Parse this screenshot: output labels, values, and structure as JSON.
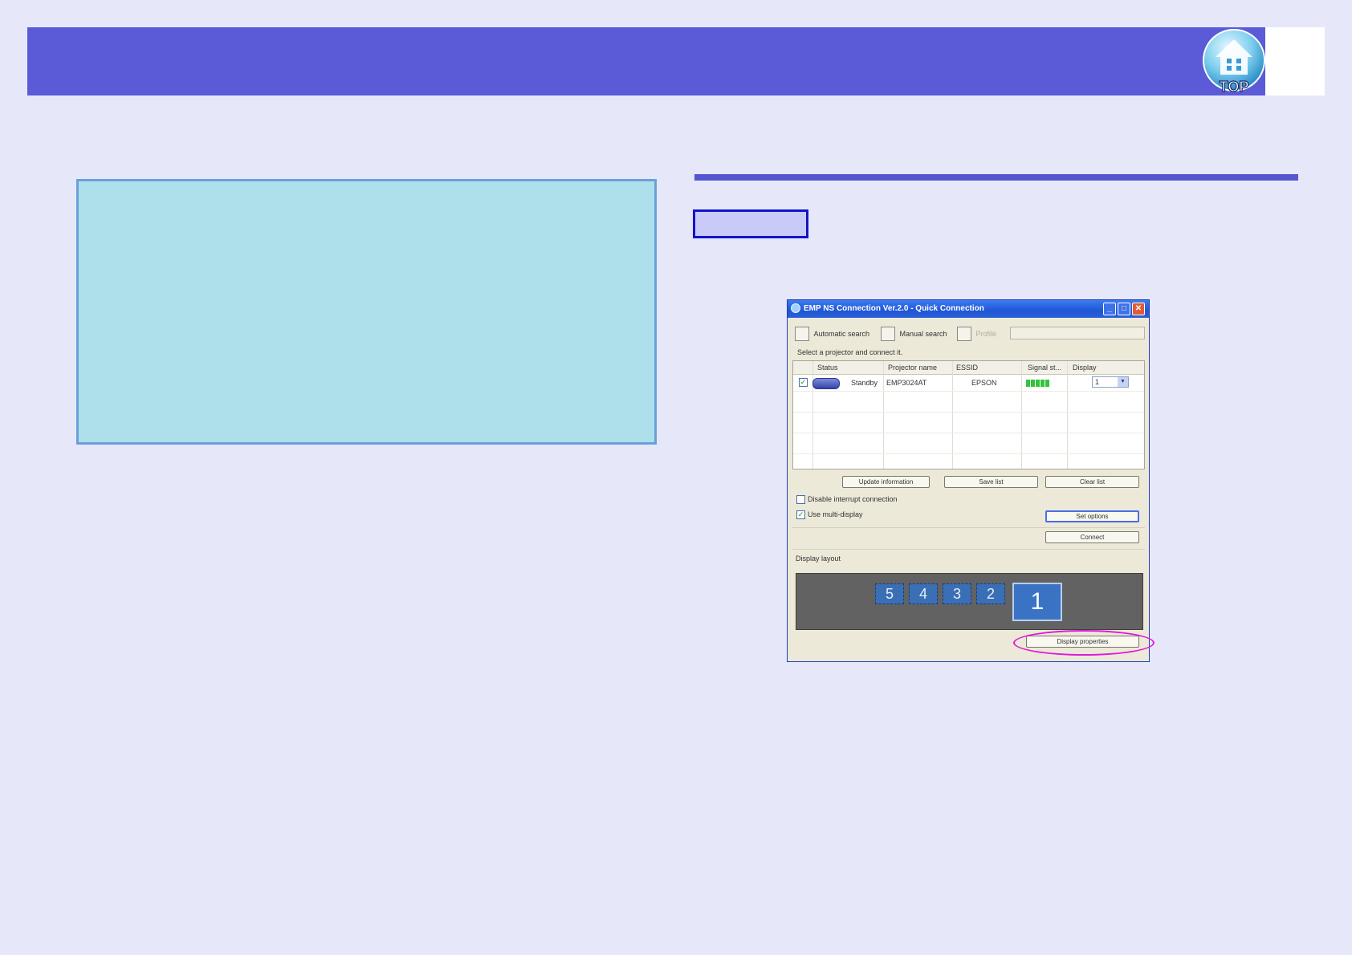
{
  "nav": {
    "top_label": "TOP"
  },
  "dialog": {
    "title": "EMP NS Connection Ver.2.0 - Quick Connection",
    "toolbar": {
      "automatic_search": "Automatic search",
      "manual_search": "Manual search",
      "third_tool": "Profile"
    },
    "hint": "Select a projector and connect it.",
    "columns": [
      "Status",
      "Projector name",
      "ESSID",
      "Signal st...",
      "Display"
    ],
    "rows": [
      {
        "checked": true,
        "status": "Standby",
        "projector_name": "EMP3024AT",
        "essid": "EPSON",
        "display": "1"
      }
    ],
    "buttons": {
      "update_information": "Update information",
      "save_list": "Save list",
      "clear_list": "Clear list",
      "set_options": "Set options",
      "connect": "Connect",
      "display_properties": "Display properties"
    },
    "checkboxes": {
      "disable_interrupt": "Disable interrupt connection",
      "use_multi_display": "Use multi-display"
    },
    "display_layout": {
      "label": "Display layout",
      "monitors": [
        "5",
        "4",
        "3",
        "2"
      ],
      "main_monitor": "1"
    }
  },
  "colors": {
    "header": "#5b5bd8",
    "info_box": "#aee0ec",
    "highlight": "#e01adb"
  }
}
